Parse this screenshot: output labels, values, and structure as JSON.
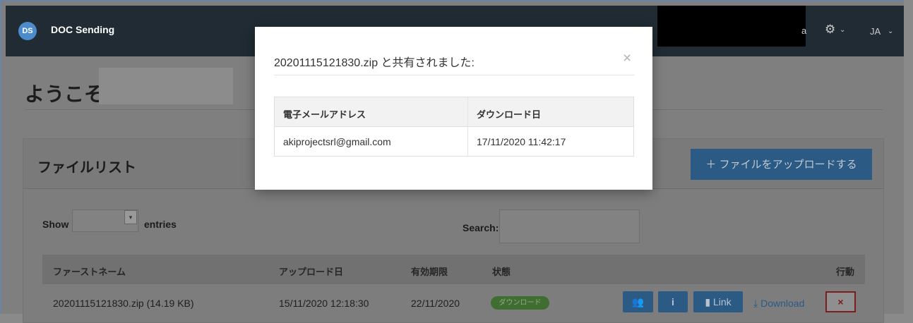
{
  "nav": {
    "logo_text": "DS",
    "brand": "DOC Sending",
    "user_fragment": "a",
    "settings_caret": "⌄",
    "lang": "JA",
    "lang_caret": "⌄"
  },
  "welcome": {
    "title": "ようこそ"
  },
  "panel": {
    "title": "ファイルリスト",
    "upload_label": "＋ ファイルをアップロードする"
  },
  "controls": {
    "show_label": "Show",
    "entries_label": "entries",
    "search_label": "Search:"
  },
  "table": {
    "columns": [
      "ファーストネーム",
      "アップロード日",
      "有効期限",
      "状態",
      "行動"
    ],
    "rows": [
      {
        "name": "20201115121830.zip (14.19 KB)",
        "upload_date": "15/11/2020 12:18:30",
        "expiry": "22/11/2020",
        "status": "ダウンロード",
        "link_label": "Link",
        "download_label": "Download",
        "delete_label": "×"
      }
    ]
  },
  "modal": {
    "title": "20201115121830.zip と共有されました:",
    "close": "×",
    "columns": [
      "電子メールアドレス",
      "ダウンロード日"
    ],
    "rows": [
      {
        "email": "akiprojectsrl@gmail.com",
        "date": "17/11/2020 11:42:17"
      }
    ]
  },
  "colors": {
    "primary": "#337ab7",
    "success": "#5cb85c",
    "danger": "#a94442",
    "navbar": "#202b33"
  },
  "icons": {
    "settings": "gear-icon",
    "users": "users-icon",
    "info": "info-icon",
    "link": "link-icon",
    "download": "download-icon",
    "delete": "close-icon",
    "select_caret": "chevron-down-icon"
  }
}
